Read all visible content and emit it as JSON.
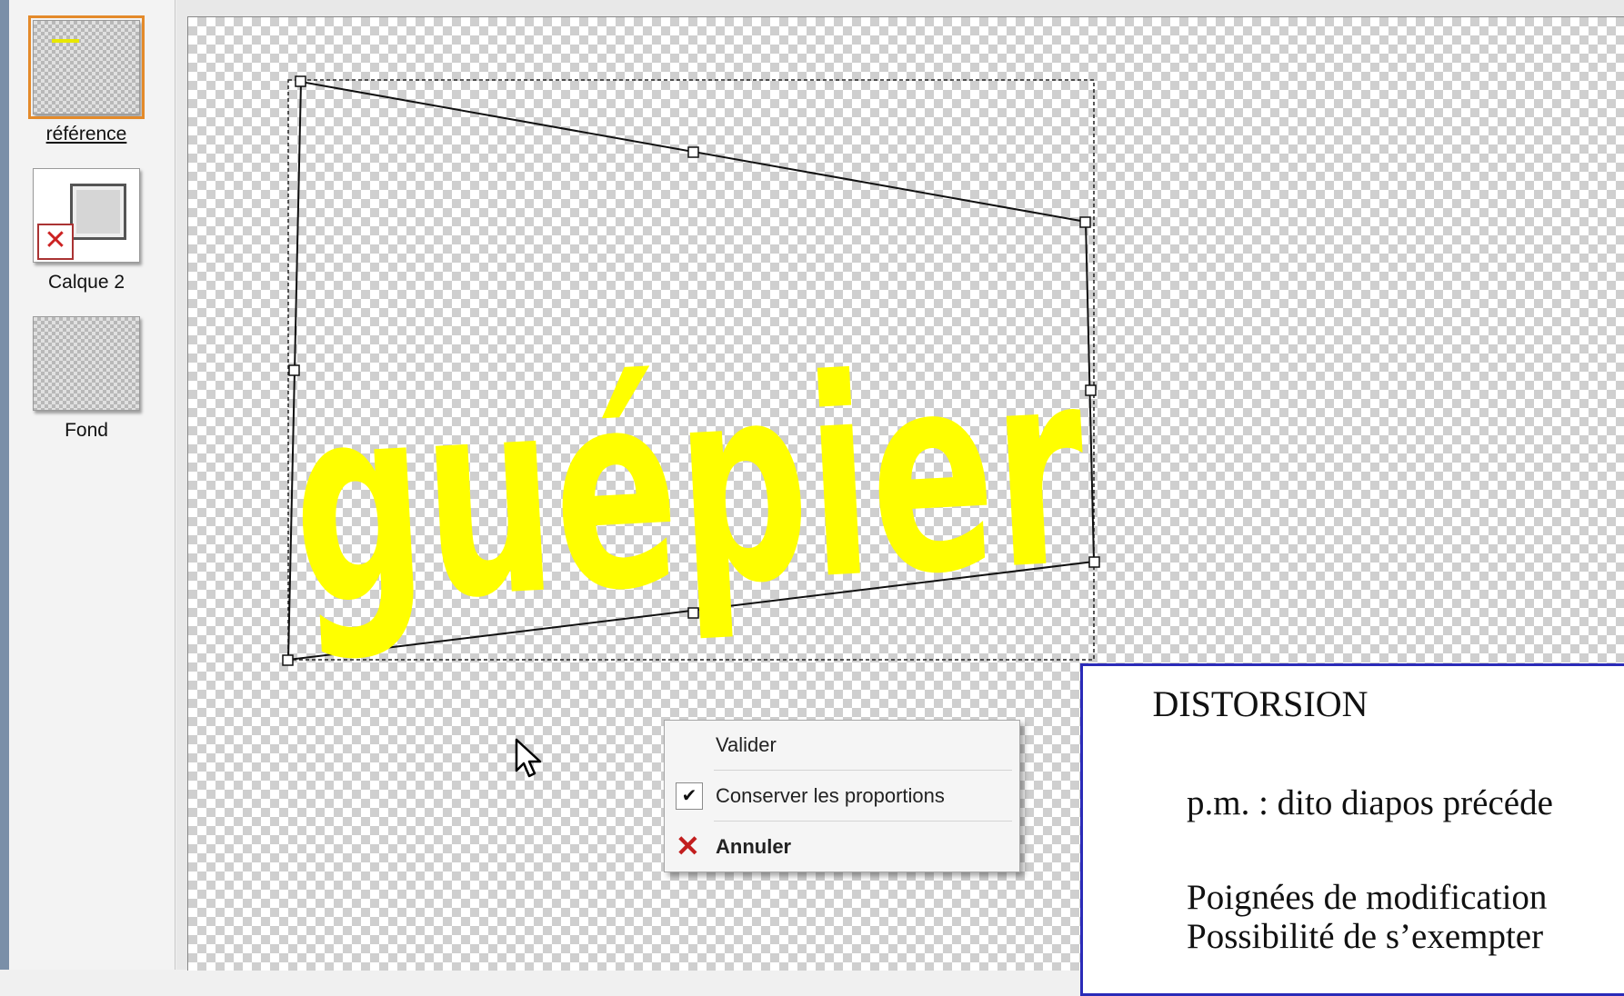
{
  "layers": [
    {
      "name": "référence",
      "active": true
    },
    {
      "name": "Calque 2",
      "active": false
    },
    {
      "name": "Fond",
      "active": false
    }
  ],
  "canvas": {
    "text": "guépier",
    "text_color": "#ffff00"
  },
  "context_menu": {
    "items": [
      {
        "label": "Valider",
        "icon": ""
      },
      {
        "label": "Conserver les proportions",
        "icon": "check-icon",
        "checked": true
      },
      {
        "label": "Annuler",
        "icon": "cancel-x-icon"
      }
    ]
  },
  "note": {
    "title": "DISTORSION",
    "lines": [
      "p.m. : dito diapos précéde",
      "Poignées de modification",
      "Possibilité de s’exempter"
    ],
    "border_color": "#2b2bb8"
  },
  "colors": {
    "accent_active_layer": "#e48a2a",
    "cancel_red": "#c21e1e"
  }
}
